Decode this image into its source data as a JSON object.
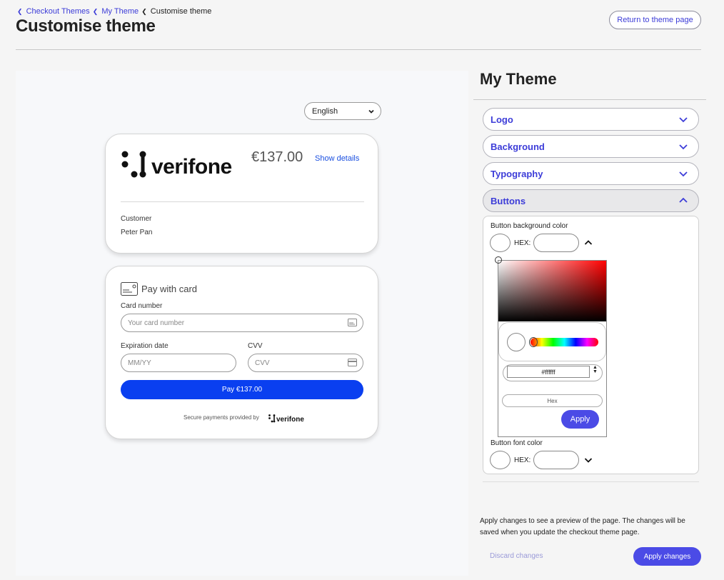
{
  "breadcrumb": {
    "items": [
      "Checkout Themes",
      "My Theme"
    ],
    "current": "Customise theme"
  },
  "header": {
    "title": "Customise theme",
    "return_button": "Return to theme page"
  },
  "preview": {
    "language": "English",
    "brand": "verifone",
    "amount": "€137.00",
    "show_details": "Show details",
    "customer_label": "Customer",
    "customer_name": "Peter Pan",
    "pay_title": "Pay with card",
    "card_number_label": "Card number",
    "card_number_placeholder": "Your card number",
    "expiration_label": "Expiration date",
    "expiration_placeholder": "MM/YY",
    "cvv_label": "CVV",
    "cvv_placeholder": "CVV",
    "pay_button": "Pay €137.00",
    "secure_text": "Secure payments provided by",
    "secure_brand": "verifone"
  },
  "sidebar": {
    "title": "My Theme",
    "sections": [
      {
        "label": "Logo",
        "open": false
      },
      {
        "label": "Background",
        "open": false
      },
      {
        "label": "Typography",
        "open": false
      },
      {
        "label": "Buttons",
        "open": true
      }
    ],
    "buttons_panel": {
      "bg_color_label": "Button background color",
      "hex_label": "HEX:",
      "font_color_label": "Button font color",
      "font_hex_label": "HEX:"
    },
    "picker": {
      "hex_value": "#ffffff",
      "mode_label": "Hex",
      "apply_label": "Apply"
    },
    "apply_note": "Apply changes to see a preview of the page. The changes will be saved when you update the checkout theme page.",
    "discard_label": "Discard changes",
    "apply_changes_label": "Apply changes"
  },
  "colors": {
    "accent": "#3c3cd8",
    "primary_button": "#4b4be6",
    "pay_button": "#0a3ff0"
  }
}
